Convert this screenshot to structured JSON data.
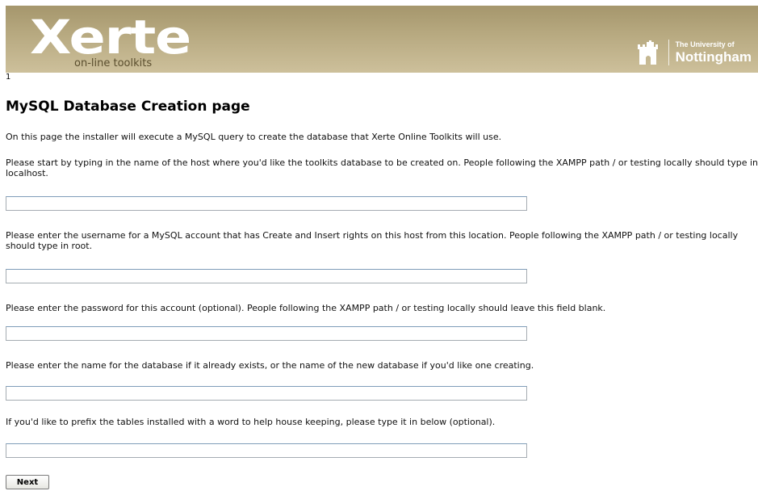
{
  "header": {
    "logo_wordmark": "Xerte",
    "logo_tagline": "on-line toolkits",
    "university_small": "The University of",
    "university_big": "Nottingham",
    "brand_color": "#b3a57b"
  },
  "step_number": "1",
  "page": {
    "title": "MySQL Database Creation page",
    "intro": "On this page the installer will execute a MySQL query to create the database that Xerte Online Toolkits will use."
  },
  "form": {
    "host": {
      "label": "Please start by typing in the name of the host where you'd like the toolkits database to be created on. People following the XAMPP path / or testing locally should type in localhost.",
      "value": ""
    },
    "username": {
      "label": "Please enter the username for a MySQL account that has Create and Insert rights on this host from this location. People following the XAMPP path / or testing locally should type in root.",
      "value": ""
    },
    "password": {
      "label": "Please enter the password for this account (optional). People following the XAMPP path / or testing locally should leave this field blank.",
      "value": ""
    },
    "database": {
      "label": "Please enter the name for the database if it already exists, or the name of the new database if you'd like one creating.",
      "value": ""
    },
    "prefix": {
      "label": "If you'd like to prefix the tables installed with a word to help house keeping, please type it in below (optional).",
      "value": ""
    },
    "next_label": "Next"
  }
}
